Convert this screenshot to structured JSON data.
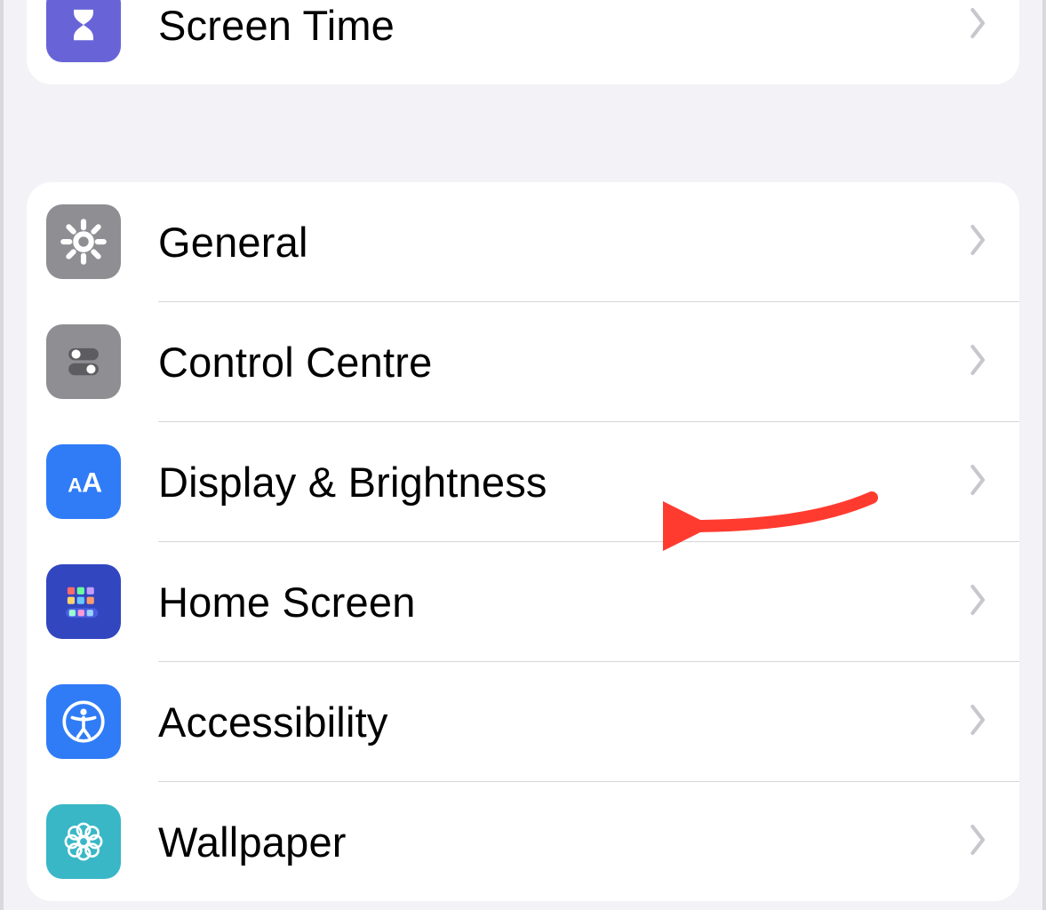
{
  "groups": [
    {
      "rows": [
        {
          "key": "screen-time",
          "label": "Screen Time",
          "icon": "hourglass",
          "bg": "bg-hourglass"
        }
      ]
    },
    {
      "rows": [
        {
          "key": "general",
          "label": "General",
          "icon": "gear",
          "bg": "bg-gear"
        },
        {
          "key": "control-centre",
          "label": "Control Centre",
          "icon": "toggles",
          "bg": "bg-toggles"
        },
        {
          "key": "display-brightness",
          "label": "Display & Brightness",
          "icon": "aa",
          "bg": "bg-aa"
        },
        {
          "key": "home-screen",
          "label": "Home Screen",
          "icon": "grid",
          "bg": "bg-grid"
        },
        {
          "key": "accessibility",
          "label": "Accessibility",
          "icon": "access",
          "bg": "bg-access"
        },
        {
          "key": "wallpaper",
          "label": "Wallpaper",
          "icon": "flower",
          "bg": "bg-flower"
        }
      ]
    }
  ],
  "annotation": {
    "target_row": "display-brightness",
    "color": "#ff3b30"
  }
}
